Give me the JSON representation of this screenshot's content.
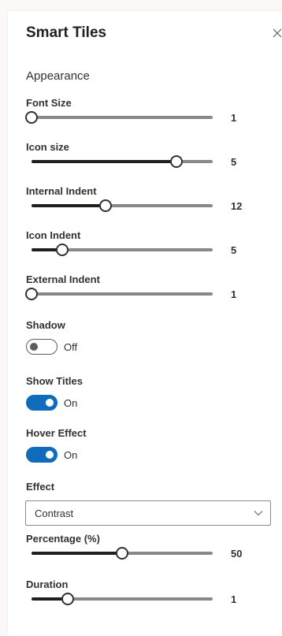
{
  "panel": {
    "title": "Smart Tiles",
    "section": "Appearance"
  },
  "sliders": [
    {
      "label": "Font Size",
      "value": "1",
      "fraction": 0.0
    },
    {
      "label": "Icon size",
      "value": "5",
      "fraction": 0.8
    },
    {
      "label": "Internal Indent",
      "value": "12",
      "fraction": 0.41
    },
    {
      "label": "Icon Indent",
      "value": "5",
      "fraction": 0.17
    },
    {
      "label": "External Indent",
      "value": "1",
      "fraction": 0.0
    },
    {
      "label": "Percentage (%)",
      "value": "50",
      "fraction": 0.5
    },
    {
      "label": "Duration",
      "value": "1",
      "fraction": 0.2
    }
  ],
  "toggles": [
    {
      "label": "Shadow",
      "state_text": "Off",
      "checked": false
    },
    {
      "label": "Show Titles",
      "state_text": "On",
      "checked": true
    },
    {
      "label": "Hover Effect",
      "state_text": "On",
      "checked": true
    }
  ],
  "effect": {
    "label": "Effect",
    "selected": "Contrast"
  },
  "icons": {
    "close": "close-icon",
    "chevron": "chevron-down-icon"
  },
  "colors": {
    "accent": "#0f6cbd",
    "track": "#8a8886",
    "fill": "#201f1e"
  }
}
